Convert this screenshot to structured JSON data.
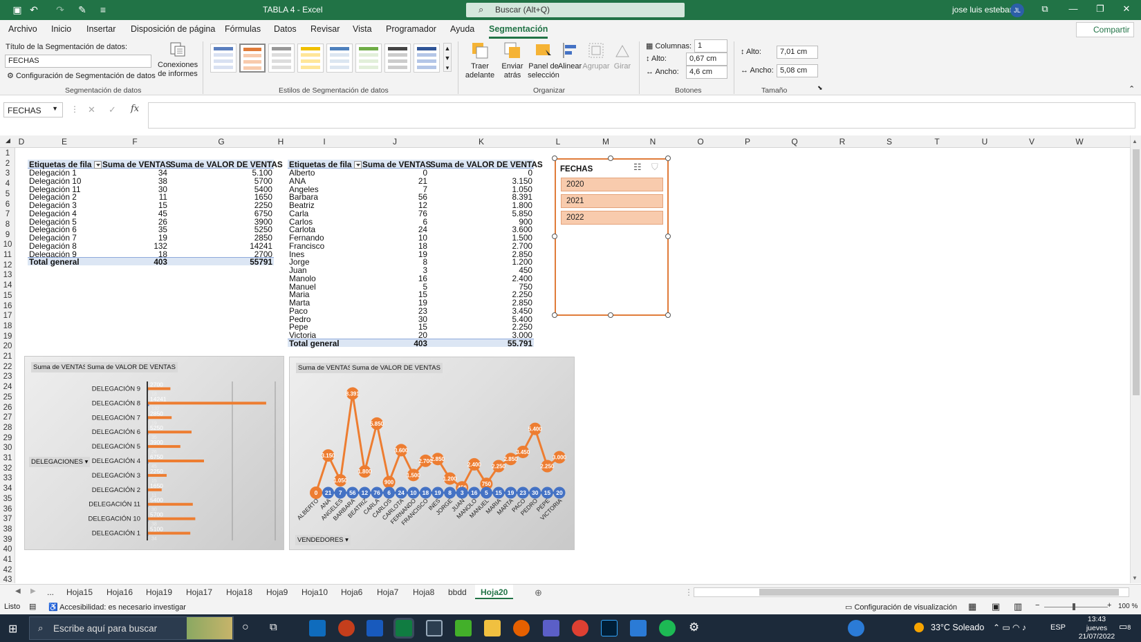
{
  "titlebar": {
    "doc_title": "TABLA 4  -  Excel",
    "search": "Buscar (Alt+Q)",
    "user": "jose luis esteban",
    "initials": "JL"
  },
  "tabs": [
    "Archivo",
    "Inicio",
    "Insertar",
    "Disposición de página",
    "Fórmulas",
    "Datos",
    "Revisar",
    "Vista",
    "Programador",
    "Ayuda",
    "Segmentación"
  ],
  "share": "Compartir",
  "ribbon": {
    "slicer_title_label": "Título de la Segmentación de datos:",
    "slicer_title_value": "FECHAS",
    "slicer_settings": "Configuración de Segmentación de datos",
    "report_conn_1": "Conexiones",
    "report_conn_2": "de informes",
    "group1": "Segmentación de datos",
    "group2": "Estilos de Segmentación de datos",
    "bring_1": "Traer",
    "bring_2": "adelante",
    "send_1": "Enviar",
    "send_2": "atrás",
    "pane_1": "Panel de",
    "pane_2": "selección",
    "align": "Alinear",
    "group_btn": "Agrupar",
    "rotate": "Girar",
    "group3": "Organizar",
    "columns_label": "Columnas:",
    "columns_value": "1",
    "height_label": "Alto:",
    "height_value": "0,67 cm",
    "width_label": "Ancho:",
    "width_value": "4,6 cm",
    "group4": "Botones",
    "size_h_label": "Alto:",
    "size_h_value": "7,01 cm",
    "size_w_label": "Ancho:",
    "size_w_value": "5,08 cm",
    "group5": "Tamaño"
  },
  "namebox": "FECHAS",
  "columns": [
    "D",
    "E",
    "F",
    "G",
    "H",
    "I",
    "J",
    "K",
    "L",
    "M",
    "N",
    "O",
    "P",
    "Q",
    "R",
    "S",
    "T",
    "U",
    "V",
    "W"
  ],
  "rows": [
    "1",
    "2",
    "3",
    "4",
    "5",
    "6",
    "7",
    "8",
    "9",
    "10",
    "11",
    "12",
    "13",
    "14",
    "15",
    "16",
    "17",
    "18",
    "19",
    "20",
    "21",
    "22",
    "23",
    "24",
    "25",
    "26",
    "27",
    "28",
    "29",
    "30",
    "31",
    "32",
    "33",
    "34",
    "35",
    "36",
    "37",
    "38",
    "39",
    "40",
    "41",
    "42",
    "43"
  ],
  "pivot1": {
    "headers": [
      "Etiquetas de fila",
      "Suma de VENTAS",
      "Suma de VALOR DE VENTAS"
    ],
    "rows": [
      [
        "Delegación 1",
        "34",
        "5.100"
      ],
      [
        "Delegación 10",
        "38",
        "5700"
      ],
      [
        "Delegación 11",
        "30",
        "5400"
      ],
      [
        "Delegación 2",
        "11",
        "1650"
      ],
      [
        "Delegación 3",
        "15",
        "2250"
      ],
      [
        "Delegación 4",
        "45",
        "6750"
      ],
      [
        "Delegación 5",
        "26",
        "3900"
      ],
      [
        "Delegación 6",
        "35",
        "5250"
      ],
      [
        "Delegación 7",
        "19",
        "2850"
      ],
      [
        "Delegación 8",
        "132",
        "14241"
      ],
      [
        "Delegación 9",
        "18",
        "2700"
      ]
    ],
    "total": [
      "Total general",
      "403",
      "55791"
    ]
  },
  "pivot2": {
    "headers": [
      "Etiquetas de fila",
      "Suma de VENTAS",
      "Suma de VALOR DE VENTAS"
    ],
    "rows": [
      [
        "Alberto",
        "0",
        "0"
      ],
      [
        "ANA",
        "21",
        "3.150"
      ],
      [
        "Angeles",
        "7",
        "1.050"
      ],
      [
        "Barbara",
        "56",
        "8.391"
      ],
      [
        "Beatriz",
        "12",
        "1.800"
      ],
      [
        "Carla",
        "76",
        "5.850"
      ],
      [
        "Carlos",
        "6",
        "900"
      ],
      [
        "Carlota",
        "24",
        "3.600"
      ],
      [
        "Fernando",
        "10",
        "1.500"
      ],
      [
        "Francisco",
        "18",
        "2.700"
      ],
      [
        "Ines",
        "19",
        "2.850"
      ],
      [
        "Jorge",
        "8",
        "1.200"
      ],
      [
        "Juan",
        "3",
        "450"
      ],
      [
        "Manolo",
        "16",
        "2.400"
      ],
      [
        "Manuel",
        "5",
        "750"
      ],
      [
        "Maria",
        "15",
        "2.250"
      ],
      [
        "Marta",
        "19",
        "2.850"
      ],
      [
        "Paco",
        "23",
        "3.450"
      ],
      [
        "Pedro",
        "30",
        "5.400"
      ],
      [
        "Pepe",
        "15",
        "2.250"
      ],
      [
        "Victoria",
        "20",
        "3.000"
      ]
    ],
    "total": [
      "Total general",
      "403",
      "55.791"
    ]
  },
  "slicer": {
    "title": "FECHAS",
    "items": [
      "2020",
      "2021",
      "2022"
    ]
  },
  "chart_data": [
    {
      "type": "bar",
      "series_buttons": [
        "Suma de VENTAS",
        "Suma de VALOR DE VENTAS"
      ],
      "axis_button": "DELEGACIONES",
      "categories": [
        "DELEGACIÓN 9",
        "DELEGACIÓN 8",
        "DELEGACIÓN 7",
        "DELEGACIÓN 6",
        "DELEGACIÓN 5",
        "DELEGACIÓN 4",
        "DELEGACIÓN 3",
        "DELEGACIÓN 2",
        "DELEGACIÓN 11",
        "DELEGACIÓN 10",
        "DELEGACIÓN 1"
      ],
      "series": [
        {
          "name": "Suma de VENTAS",
          "values": [
            18,
            132,
            19,
            35,
            26,
            45,
            15,
            11,
            30,
            38,
            34
          ]
        },
        {
          "name": "Suma de VALOR DE VENTAS",
          "values": [
            2700,
            14241,
            2850,
            5250,
            3900,
            6750,
            2250,
            1650,
            5400,
            5700,
            5100
          ]
        }
      ],
      "value_labels": [
        "2700",
        "14241",
        "2850",
        "5250",
        "3900",
        "6750",
        "2250",
        "1650",
        "5400",
        "5700",
        "5100"
      ],
      "colors": {
        "bar": "#ed7d31"
      },
      "xlim": [
        0,
        15000
      ]
    },
    {
      "type": "line",
      "series_buttons": [
        "Suma de VENTAS",
        "Suma de VALOR DE VENTAS"
      ],
      "axis_button": "VENDEDORES",
      "categories": [
        "ALBERTO",
        "ANA",
        "ANGELES",
        "BARBARA",
        "BEATRIZ",
        "CARLA",
        "CARLOS",
        "CARLOTA",
        "FERNANDO",
        "FRANCISCO",
        "INES",
        "JORGE",
        "JUAN",
        "MANOLO",
        "MANUEL",
        "MARIA",
        "MARTA",
        "PACO",
        "PEDRO",
        "PEPE",
        "VICTORIA"
      ],
      "series": [
        {
          "name": "Suma de VENTAS",
          "values": [
            0,
            21,
            7,
            56,
            12,
            76,
            6,
            24,
            10,
            18,
            19,
            8,
            3,
            16,
            5,
            15,
            19,
            23,
            30,
            15,
            20
          ]
        },
        {
          "name": "Suma de VALOR DE VENTAS",
          "values": [
            0,
            3150,
            1050,
            8391,
            1800,
            5850,
            900,
            3600,
            1500,
            2700,
            2850,
            1200,
            450,
            2400,
            750,
            2250,
            2850,
            3450,
            5400,
            2250,
            3000
          ]
        }
      ],
      "labels_ventas": [
        "0",
        "21",
        "7",
        "56",
        "12",
        "76",
        "6",
        "24",
        "10",
        "18",
        "19",
        "8",
        "3",
        "16",
        "5",
        "15",
        "19",
        "23",
        "30",
        "15",
        "20"
      ],
      "labels_valor": [
        "0",
        "3.150",
        "1.050",
        "8.391",
        "1.800",
        "5.850",
        "900",
        "3.600",
        "1.500",
        "2.700",
        "2.850",
        "1.200",
        "450",
        "2.400",
        "750",
        "2.250",
        "2.850",
        "3.450",
        "5.400",
        "2.250",
        "3.000"
      ],
      "colors": {
        "ventas": "#4472c4",
        "valor": "#ed7d31"
      },
      "ylim": [
        0,
        9000
      ]
    }
  ],
  "sheets": [
    "...",
    "Hoja15",
    "Hoja16",
    "Hoja19",
    "Hoja17",
    "Hoja18",
    "Hoja9",
    "Hoja10",
    "Hoja6",
    "Hoja7",
    "Hoja8",
    "bbdd",
    "Hoja20"
  ],
  "status": {
    "ready": "Listo",
    "accessibility": "Accesibilidad: es necesario investigar",
    "display_settings": "Configuración de visualización",
    "zoom": "100 %"
  },
  "taskbar": {
    "search": "Escribe aquí para buscar",
    "weather": "33°C  Soleado",
    "lang": "ESP",
    "time": "13:43",
    "day": "jueves",
    "date": "21/07/2022",
    "notif": "8"
  }
}
